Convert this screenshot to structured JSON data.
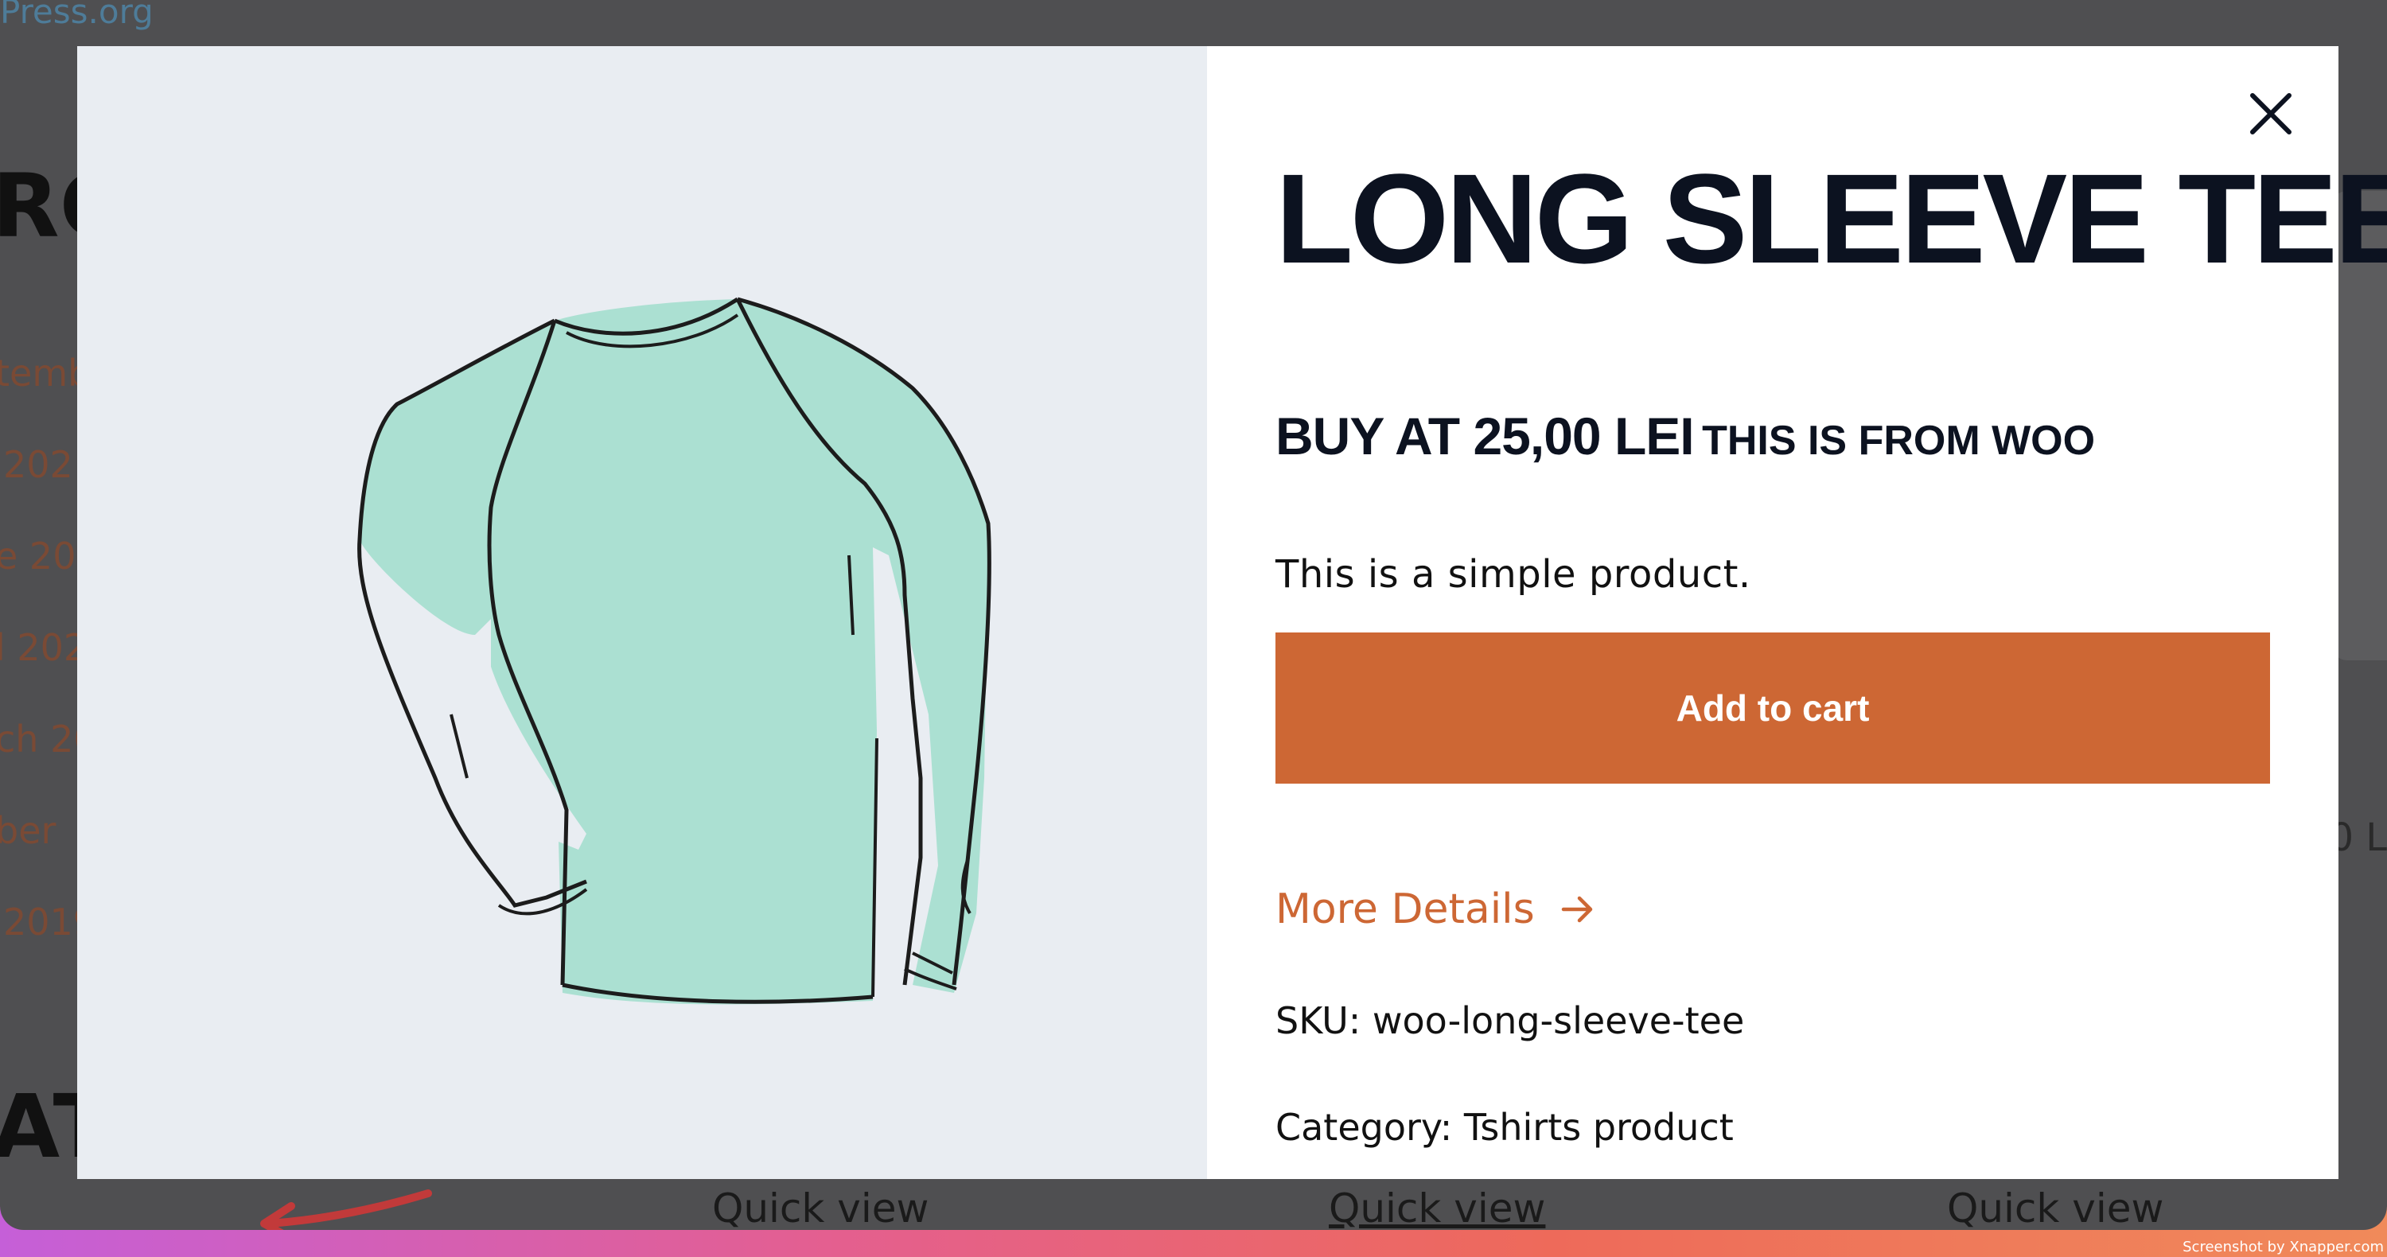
{
  "background_page": {
    "site_link": "Press.org",
    "heading_fragment": "RC",
    "archive_fragments": [
      "temb",
      "202",
      "e 202",
      "l 202",
      "ch 20",
      "ber",
      "2019"
    ],
    "bottom_heading_fragment": "AT",
    "right_fragment": "0 L",
    "quick_view_labels": [
      "Quick view",
      "Quick view",
      "Quick view"
    ]
  },
  "modal": {
    "title": "LONG SLEEVE TEE",
    "price_line": "BUY AT 25,00 LEI",
    "price_suffix": "THIS IS FROM WOO",
    "description": "This is a simple product.",
    "add_to_cart_label": "Add to cart",
    "more_details_label": "More Details",
    "sku": "SKU: woo-long-sleeve-tee",
    "category": "Category: Tshirts product",
    "image_icon": "long-sleeve-shirt-illustration"
  },
  "colors": {
    "accent": "#cd6734",
    "title": "#0c1220",
    "image_bg": "#e9edf2",
    "shirt_fill": "#a8dfd0"
  },
  "watermark": "Screenshot by Xnapper.com"
}
